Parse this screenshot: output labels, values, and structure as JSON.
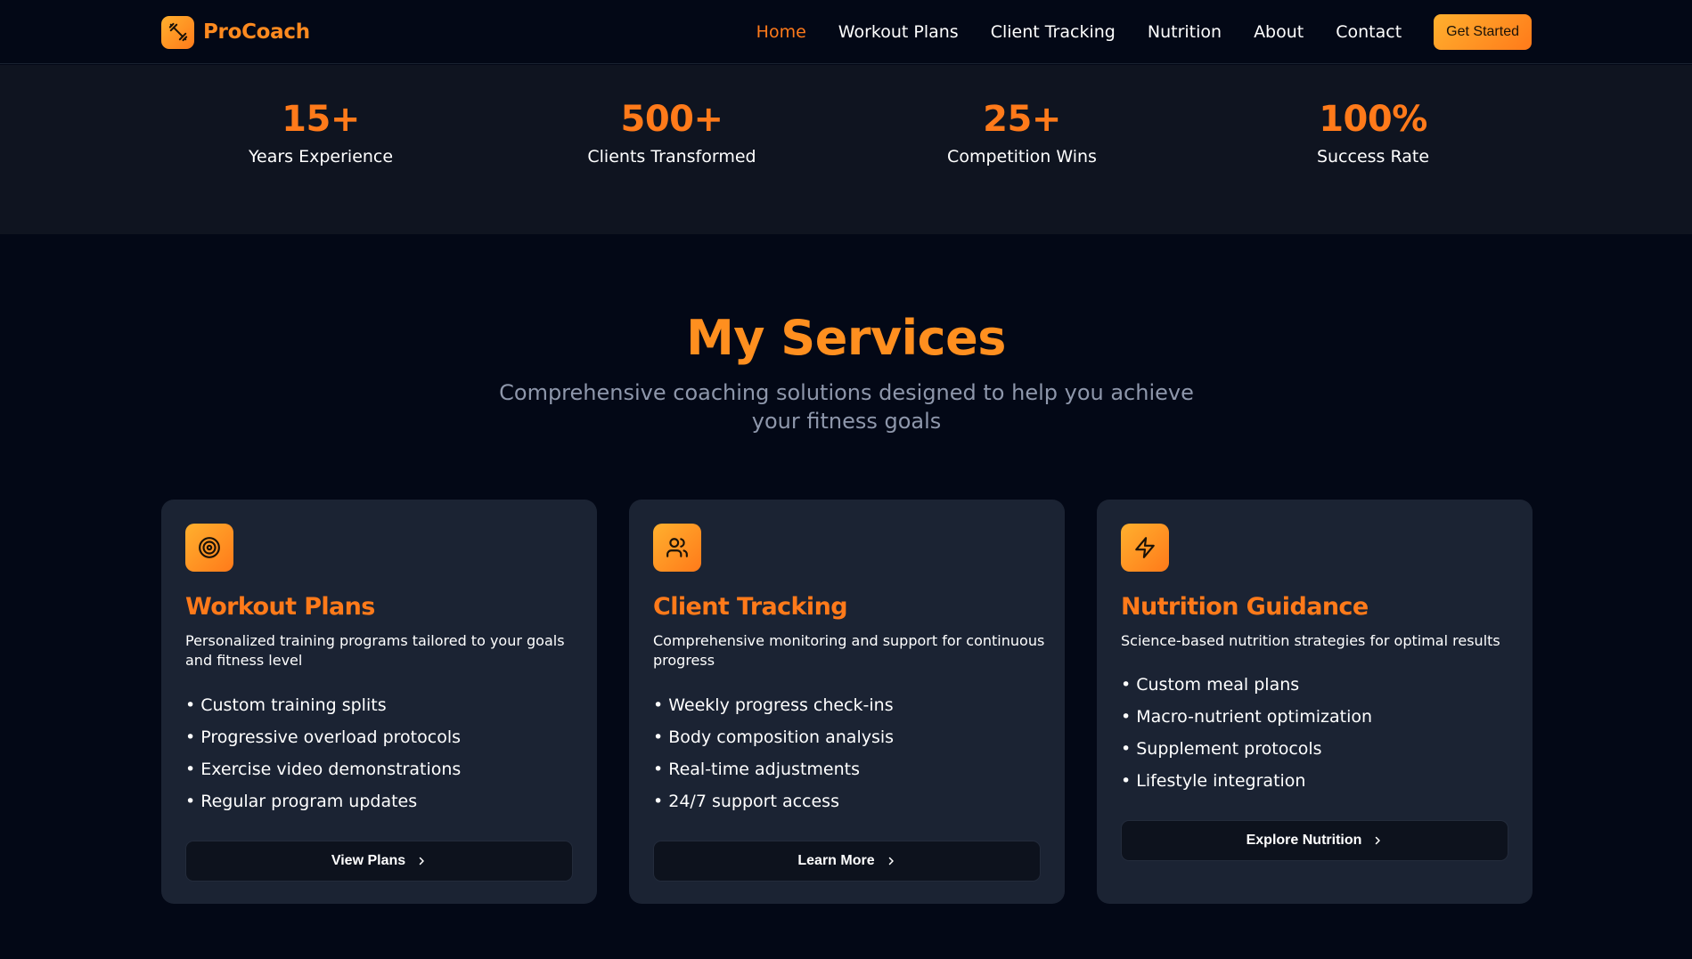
{
  "brand": {
    "name": "ProCoach",
    "icon": "dumbbell-icon"
  },
  "nav": {
    "links": [
      "Home",
      "Workout Plans",
      "Client Tracking",
      "Nutrition",
      "About",
      "Contact"
    ],
    "active": "Home",
    "cta_label": "Get Started"
  },
  "stats": [
    {
      "value": "15+",
      "label": "Years Experience"
    },
    {
      "value": "500+",
      "label": "Clients Transformed"
    },
    {
      "value": "25+",
      "label": "Competition Wins"
    },
    {
      "value": "100%",
      "label": "Success Rate"
    }
  ],
  "services": {
    "title": "My Services",
    "subtitle": "Comprehensive coaching solutions designed to help you achieve your fitness goals",
    "cards": [
      {
        "icon": "target-icon",
        "title": "Workout Plans",
        "description": "Personalized training programs tailored to your goals and fitness level",
        "items": [
          "• Custom training splits",
          "• Progressive overload protocols",
          "• Exercise video demonstrations",
          "• Regular program updates"
        ],
        "button_label": "View Plans"
      },
      {
        "icon": "users-icon",
        "title": "Client Tracking",
        "description": "Comprehensive monitoring and support for continuous progress",
        "items": [
          "• Weekly progress check-ins",
          "• Body composition analysis",
          "• Real-time adjustments",
          "• 24/7 support access"
        ],
        "button_label": "Learn More"
      },
      {
        "icon": "lightning-icon",
        "title": "Nutrition Guidance",
        "description": "Science-based nutrition strategies for optimal results",
        "items": [
          "• Custom meal plans",
          "• Macro-nutrient optimization",
          "• Supplement protocols",
          "• Lifestyle integration"
        ],
        "button_label": "Explore Nutrition"
      }
    ]
  },
  "colors": {
    "accent": "#ff7a1a",
    "accent_light": "#ffb02e",
    "background": "#030816",
    "card": "#1b2333",
    "stats_band": "#0f1420"
  }
}
